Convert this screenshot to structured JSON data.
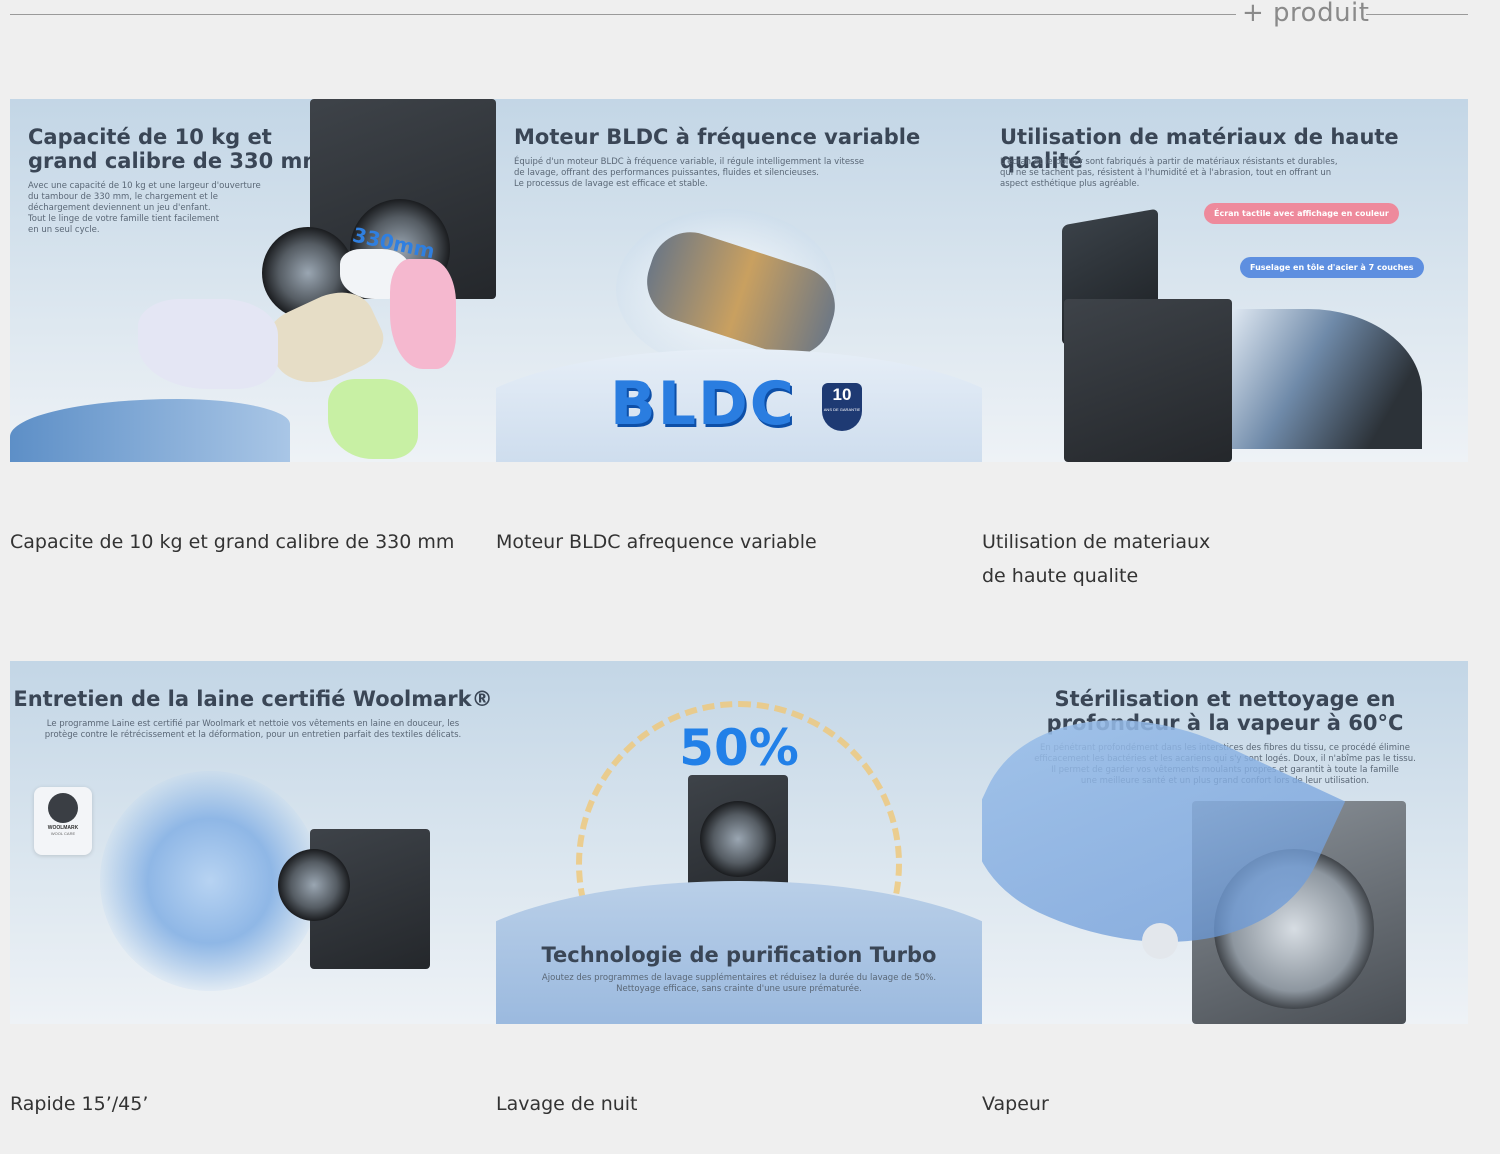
{
  "section": {
    "label": "+ produit"
  },
  "cards": [
    {
      "headline_l1": "Capacité de 10 kg et",
      "headline_l2": "grand calibre de 330 mm",
      "body_l1": "Avec une capacité de 10 kg et une largeur d'ouverture",
      "body_l2": "du tambour de 330 mm, le chargement et le",
      "body_l3": "déchargement deviennent un jeu d'enfant.",
      "body_l4": "Tout le linge de votre famille tient facilement",
      "body_l5": "en un seul cycle.",
      "badge": "330mm",
      "caption_l1": "Capacite de 10 kg et grand calibre de 330 mm",
      "caption_l2": ""
    },
    {
      "headline_l1": "Moteur BLDC à fréquence variable",
      "body_l1": "Équipé d'un moteur BLDC à fréquence variable, il régule intelligemment la vitesse",
      "body_l2": "de lavage, offrant des performances puissantes, fluides et silencieuses.",
      "body_l3": "Le processus de lavage est efficace et stable.",
      "badge": "BLDC",
      "badge2": "10",
      "badge2_sub": "ANS DE GARANTIE",
      "caption_l1": "Moteur BLDC afrequence variable",
      "caption_l2": ""
    },
    {
      "headline_l1": "Utilisation de matériaux de haute qualité",
      "body_l1": "L'écran et le boîtier sont fabriqués à partir de matériaux résistants et durables,",
      "body_l2": "qui ne se tachent pas, résistent à l'humidité et à l'abrasion, tout en offrant un",
      "body_l3": "aspect esthétique plus agréable.",
      "pill1": "Écran tactile avec affichage en couleur",
      "pill2": "Fuselage en tôle d'acier à 7 couches",
      "caption_l1": "Utilisation de materiaux",
      "caption_l2": "de haute qualite"
    },
    {
      "headline_l1": "Entretien de la laine certifié Woolmark®",
      "body_l1": "Le programme Laine est certifié par Woolmark et nettoie vos vêtements en laine en douceur, les",
      "body_l2": "protège contre le rétrécissement et la déformation, pour un entretien parfait des textiles délicats.",
      "badge": "WOOLMARK",
      "badge_sub": "WOOL CARE",
      "caption_l1": "Rapide 15’/45’",
      "caption_l2": ""
    },
    {
      "headline_l1": "Technologie de purification Turbo",
      "body_l1": "Ajoutez des programmes de lavage supplémentaires et réduisez la durée du lavage de 50%.",
      "body_l2": "Nettoyage efficace, sans crainte d'une usure prématurée.",
      "badge": "50%",
      "caption_l1": "Lavage de nuit",
      "caption_l2": ""
    },
    {
      "headline_l1": "Stérilisation et nettoyage en",
      "headline_l2": "profondeur à la vapeur à 60°C",
      "body_l1": "En pénétrant profondément dans les interstices des fibres du tissu, ce procédé élimine",
      "body_l2": "efficacement les bactéries et les acariens qui s'y sont logés. Doux, il n'abîme pas le tissu.",
      "body_l3": "Il permet de garder vos vêtements moulants propres et garantit à toute la famille",
      "body_l4": "une meilleure santé et un plus grand confort lors de leur utilisation.",
      "caption_l1": "Vapeur",
      "caption_l2": ""
    }
  ]
}
